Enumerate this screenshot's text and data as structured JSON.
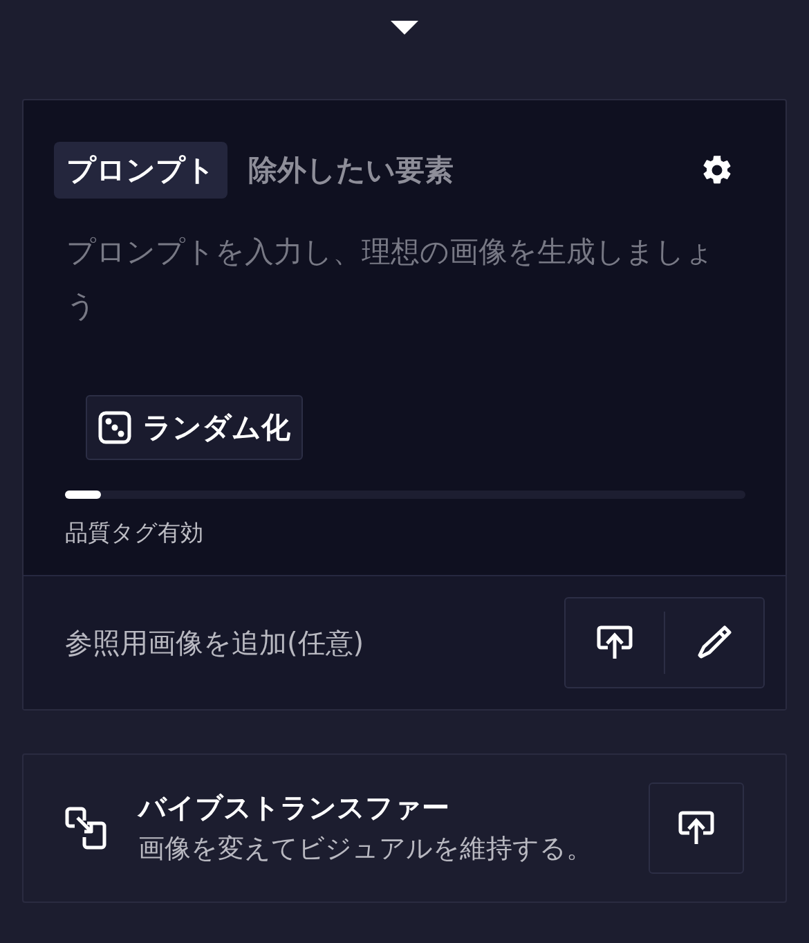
{
  "tabs": [
    {
      "label": "プロンプト",
      "selected": true
    },
    {
      "label": "除外したい要素",
      "selected": false
    }
  ],
  "prompt": {
    "placeholder": "プロンプトを入力し、理想の画像を生成しましょう"
  },
  "randomize_button": {
    "label": "ランダム化"
  },
  "quality_tags": {
    "level": 0.053,
    "label": "品質タグ有効"
  },
  "reference": {
    "label": "参照用画像を追加(任意)"
  },
  "vibe_transfer": {
    "title": "バイブストランスファー",
    "subtitle": "画像を変えてビジュアルを維持する。"
  }
}
